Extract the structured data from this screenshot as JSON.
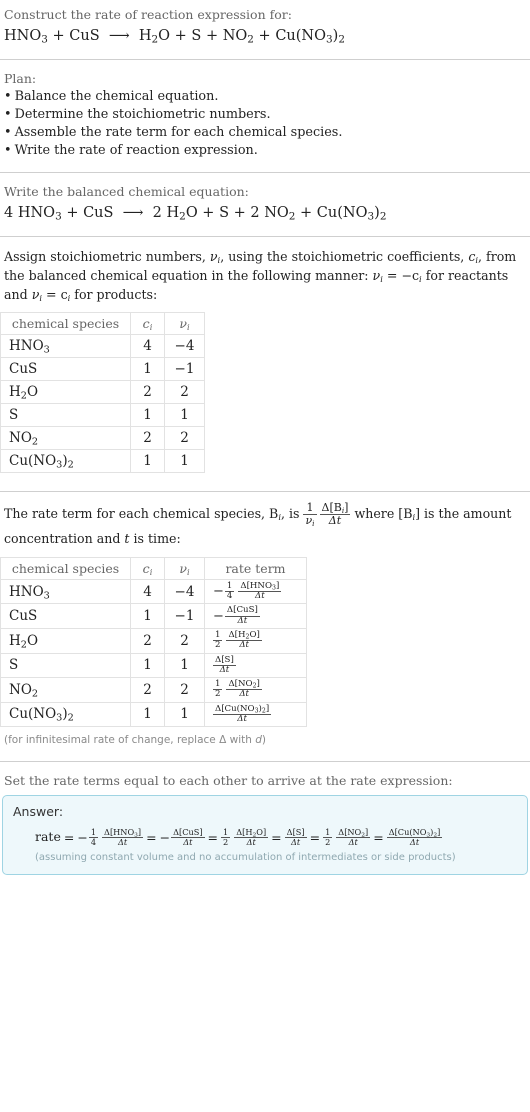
{
  "prompt": {
    "label": "Construct the rate of reaction expression for:",
    "equation": {
      "reactants": [
        {
          "formula": "HNO",
          "sub": "3"
        },
        {
          "formula": "CuS",
          "sub": ""
        }
      ],
      "arrow": "⟶",
      "products": [
        {
          "formula": "H",
          "sub": "2",
          "tail": "O"
        },
        {
          "formula": "S",
          "sub": ""
        },
        {
          "formula": "NO",
          "sub": "2"
        },
        {
          "formula": "Cu(NO",
          "sub": "3",
          "tail": ")",
          "sub2": "2"
        }
      ],
      "plain": "HNO3 + CuS ⟶ H2O + S + NO2 + Cu(NO3)2"
    }
  },
  "plan": {
    "heading": "Plan:",
    "items": [
      "Balance the chemical equation.",
      "Determine the stoichiometric numbers.",
      "Assemble the rate term for each chemical species.",
      "Write the rate of reaction expression."
    ],
    "bullet": "•"
  },
  "balanced": {
    "label": "Write the balanced chemical equation:",
    "coefficients": {
      "HNO3": 4,
      "CuS": 1,
      "H2O": 2,
      "S": 1,
      "NO2": 2,
      "Cu(NO3)2": 1
    },
    "plain": "4 HNO3 + CuS ⟶ 2 H2O + S + 2 NO2 + Cu(NO3)2"
  },
  "assign": {
    "text_1": "Assign stoichiometric numbers, ",
    "sym_v": "ν",
    "text_2": ", using the stoichiometric coefficients, ",
    "sym_c": "c",
    "text_3": ", from the balanced chemical equation in the following manner: ",
    "rule_reactants": "= −c",
    "text_4": " for reactants and ",
    "rule_products": "= c",
    "text_5": " for products:"
  },
  "stoich_table": {
    "headers": [
      "chemical species",
      "c",
      "ν"
    ],
    "rows": [
      {
        "species": "HNO3",
        "display": [
          "HNO",
          "3"
        ],
        "ci": "4",
        "vi": "−4"
      },
      {
        "species": "CuS",
        "display": [
          "CuS",
          ""
        ],
        "ci": "1",
        "vi": "−1"
      },
      {
        "species": "H2O",
        "display": [
          "H",
          "2",
          "O"
        ],
        "ci": "2",
        "vi": "2"
      },
      {
        "species": "S",
        "display": [
          "S",
          ""
        ],
        "ci": "1",
        "vi": "1"
      },
      {
        "species": "NO2",
        "display": [
          "NO",
          "2"
        ],
        "ci": "2",
        "vi": "2"
      },
      {
        "species": "Cu(NO3)2",
        "display": [
          "Cu(NO",
          "3",
          ")",
          "2"
        ],
        "ci": "1",
        "vi": "1"
      }
    ]
  },
  "rate_intro": {
    "text_1": "The rate term for each chemical species, B",
    "text_2": ", is ",
    "frac_num": "1",
    "frac_den": "ν",
    "delta_num": "Δ[B",
    "delta_den": "Δt",
    "text_3": " where [B",
    "text_4": "] is the amount concentration and ",
    "text_5": " is time:"
  },
  "rate_table": {
    "headers": [
      "chemical species",
      "c",
      "ν",
      "rate term"
    ],
    "rows": [
      {
        "species": "HNO3",
        "ci": "4",
        "vi": "−4",
        "sign": "−",
        "coef_num": "1",
        "coef_den": "4",
        "delta": "Δ[HNO3]",
        "dt": "Δt"
      },
      {
        "species": "CuS",
        "ci": "1",
        "vi": "−1",
        "sign": "−",
        "coef_num": "",
        "coef_den": "",
        "delta": "Δ[CuS]",
        "dt": "Δt"
      },
      {
        "species": "H2O",
        "ci": "2",
        "vi": "2",
        "sign": "",
        "coef_num": "1",
        "coef_den": "2",
        "delta": "Δ[H2O]",
        "dt": "Δt"
      },
      {
        "species": "S",
        "ci": "1",
        "vi": "1",
        "sign": "",
        "coef_num": "",
        "coef_den": "",
        "delta": "Δ[S]",
        "dt": "Δt"
      },
      {
        "species": "NO2",
        "ci": "2",
        "vi": "2",
        "sign": "",
        "coef_num": "1",
        "coef_den": "2",
        "delta": "Δ[NO2]",
        "dt": "Δt"
      },
      {
        "species": "Cu(NO3)2",
        "ci": "1",
        "vi": "1",
        "sign": "",
        "coef_num": "",
        "coef_den": "",
        "delta": "Δ[Cu(NO3)2]",
        "dt": "Δt"
      }
    ]
  },
  "infinitesimal_note": "(for infinitesimal rate of change, replace Δ with d)",
  "final": {
    "label": "Set the rate terms equal to each other to arrive at the rate expression:",
    "answer_label": "Answer:",
    "rate_word": "rate",
    "expression_plain": "rate = −1/4 Δ[HNO3]/Δt = −Δ[CuS]/Δt = 1/2 Δ[H2O]/Δt = Δ[S]/Δt = 1/2 Δ[NO2]/Δt = Δ[Cu(NO3)2]/Δt",
    "terms": [
      {
        "sign": "−",
        "coef_num": "1",
        "coef_den": "4",
        "delta": "Δ[HNO3]",
        "dt": "Δt"
      },
      {
        "sign": "−",
        "coef_num": "",
        "coef_den": "",
        "delta": "Δ[CuS]",
        "dt": "Δt"
      },
      {
        "sign": "",
        "coef_num": "1",
        "coef_den": "2",
        "delta": "Δ[H2O]",
        "dt": "Δt"
      },
      {
        "sign": "",
        "coef_num": "",
        "coef_den": "",
        "delta": "Δ[S]",
        "dt": "Δt"
      },
      {
        "sign": "",
        "coef_num": "1",
        "coef_den": "2",
        "delta": "Δ[NO2]",
        "dt": "Δt"
      },
      {
        "sign": "",
        "coef_num": "",
        "coef_den": "",
        "delta": "Δ[Cu(NO3)2]",
        "dt": "Δt"
      }
    ],
    "assumption": "(assuming constant volume and no accumulation of intermediates or side products)"
  },
  "colors": {
    "text": "#222222",
    "muted": "#666666",
    "rule": "#cfcfcf",
    "table_border": "#e2e2e2",
    "answer_bg": "#eef8fb",
    "answer_border": "#9fd4e3",
    "answer_note": "#8fa8b0"
  }
}
